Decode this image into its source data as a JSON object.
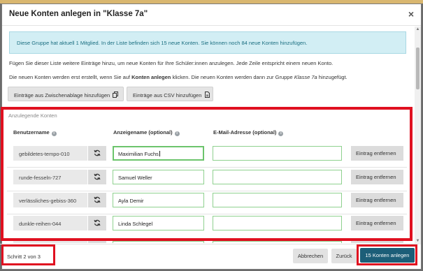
{
  "dialog": {
    "title": "Neue Konten anlegen in \"Klasse 7a\"",
    "close_label": "×"
  },
  "info": "Diese Gruppe hat aktuell 1 Mitglied. In der Liste befinden sich 15 neue Konten. Sie können noch 84 neue Konten hinzufügen.",
  "intro": {
    "line1": "Fügen Sie dieser Liste weitere Einträge hinzu, um neue Konten für Ihre Schüler:innen anzulegen. Jede Zeile entspricht einem neuen Konto.",
    "line2_a": "Die neuen Konten werden erst erstellt, wenn Sie auf ",
    "line2_b": "Konten anlegen",
    "line2_c": " klicken. Die neuen Konten werden dann zur Gruppe ",
    "line2_d": "Klasse 7a",
    "line2_e": " hinzugefügt."
  },
  "toolbar": {
    "clipboard_label": "Einträge aus Zwischenablage hinzufügen",
    "csv_label": "Einträge aus CSV hinzufügen"
  },
  "section": {
    "label": "Anzulegende Konten",
    "columns": {
      "username": "Benutzername",
      "display_name": "Anzeigename (optional)",
      "email": "E-Mail-Adresse (optional)"
    }
  },
  "rows": [
    {
      "username": "gebildetes-tempo-010",
      "display_name": "Maximilian  Fuchs",
      "email": "",
      "remove_label": "Eintrag entfernen"
    },
    {
      "username": "runde-fesseln-727",
      "display_name": "Samuel Weller",
      "email": "",
      "remove_label": "Eintrag entfernen"
    },
    {
      "username": "verlässliches-gebiss-360",
      "display_name": "Ayla Demir",
      "email": "",
      "remove_label": "Eintrag entfernen"
    },
    {
      "username": "dunkle-reihen-044",
      "display_name": "Linda Schlegel",
      "email": "",
      "remove_label": "Eintrag entfernen"
    }
  ],
  "footer": {
    "step": "Schritt 2 von 3",
    "cancel_label": "Abbrechen",
    "back_label": "Zurück",
    "create_label": "15 Konten anlegen"
  },
  "colors": {
    "accent": "#1c5e78",
    "highlight": "#e01020",
    "info_bg": "#d2eef4",
    "valid_border": "#8fd18f"
  }
}
